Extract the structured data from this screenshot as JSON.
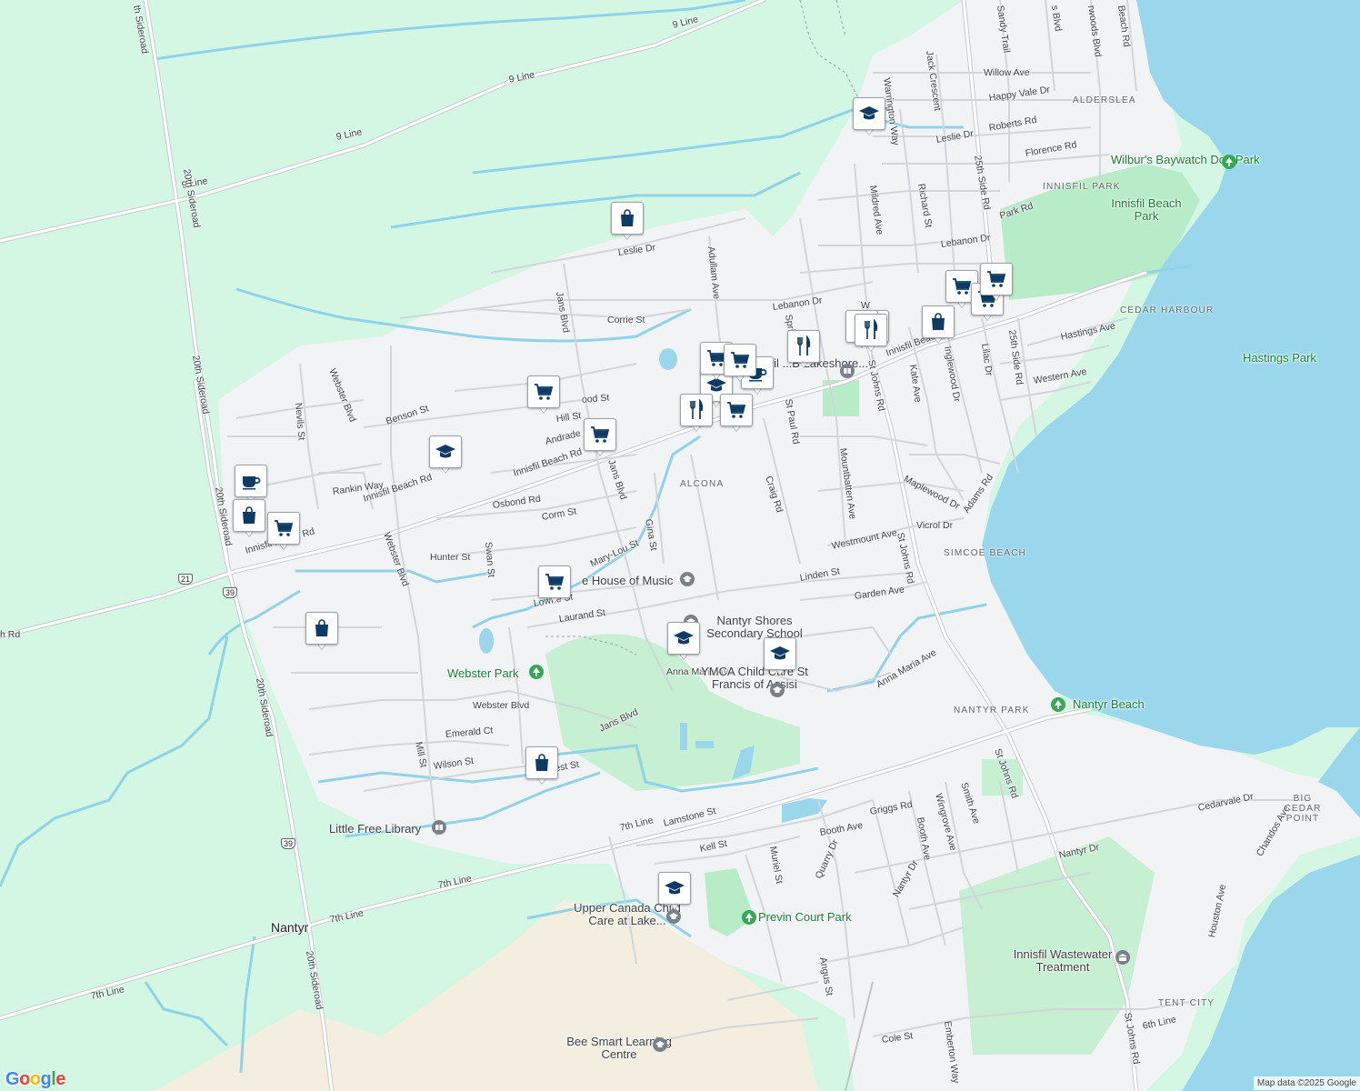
{
  "map": {
    "water_color": "#9bd7ec",
    "land_color": "#f1f3f4",
    "green_color": "#d4f7e4",
    "park_color": "#b8ebc7",
    "road_color": "#ffffff",
    "pin_icon_color": "#0d3b66"
  },
  "streets": [
    {
      "name": "9 Line"
    },
    {
      "name": "9 Line"
    },
    {
      "name": "9 Line"
    },
    {
      "name": "9 Line"
    },
    {
      "name": "20th Sideroad"
    },
    {
      "name": "20th Sideroad"
    },
    {
      "name": "20th Sideroad"
    },
    {
      "name": "20th Sideroad"
    },
    {
      "name": "20th Sideroad"
    },
    {
      "name": "th Sideroad"
    },
    {
      "name": "Leslie Dr"
    },
    {
      "name": "Corrie St"
    },
    {
      "name": "Jans Blvd"
    },
    {
      "name": "Adullam Ave"
    },
    {
      "name": "Lebanon Dr"
    },
    {
      "name": "Innisfil Beach Rd"
    },
    {
      "name": "Innisfil Beach Rd"
    },
    {
      "name": "Innisfil Beach Rd"
    },
    {
      "name": "Innisfil Beach Rd"
    },
    {
      "name": "Webster Blvd"
    },
    {
      "name": "Webster Blvd"
    },
    {
      "name": "Webster Blvd"
    },
    {
      "name": "Nevils St"
    },
    {
      "name": "Benson St"
    },
    {
      "name": "Rankin Way"
    },
    {
      "name": "Hill St"
    },
    {
      "name": "ood St"
    },
    {
      "name": "Andrade"
    },
    {
      "name": "Jans Blvd"
    },
    {
      "name": "Osbond Rd"
    },
    {
      "name": "Corm St"
    },
    {
      "name": "Swan St"
    },
    {
      "name": "Hunter St"
    },
    {
      "name": "Mary-Lou St"
    },
    {
      "name": "Gina St"
    },
    {
      "name": "Lowrie St"
    },
    {
      "name": "Laurand St"
    },
    {
      "name": "Craig Rd"
    },
    {
      "name": "St Paul Rd"
    },
    {
      "name": "Mountbatten Ave"
    },
    {
      "name": "Westmount Ave"
    },
    {
      "name": "Linden St"
    },
    {
      "name": "Garden Ave"
    },
    {
      "name": "Anna Maria Ave"
    },
    {
      "name": "Anna Maria Ave"
    },
    {
      "name": "Jans Blvd"
    },
    {
      "name": "Emerald Ct"
    },
    {
      "name": "Mill St"
    },
    {
      "name": "Wilson St"
    },
    {
      "name": "rest St"
    },
    {
      "name": "7th Line"
    },
    {
      "name": "7th Line"
    },
    {
      "name": "7th Line"
    },
    {
      "name": "7th Line"
    },
    {
      "name": "Lamstone St"
    },
    {
      "name": "Kell St"
    },
    {
      "name": "Booth Ave"
    },
    {
      "name": "Griggs Rd"
    },
    {
      "name": "Muriel St"
    },
    {
      "name": "Quarry Dr"
    },
    {
      "name": "Angus St"
    },
    {
      "name": "Nantyr Dr"
    },
    {
      "name": "Booth Ave"
    },
    {
      "name": "Wingrove Ave"
    },
    {
      "name": "Smith Ave"
    },
    {
      "name": "Nantyr Dr"
    },
    {
      "name": "Cedarvale Dr"
    },
    {
      "name": "Chandos Ave"
    },
    {
      "name": "Houston Ave"
    },
    {
      "name": "6th Line"
    },
    {
      "name": "Cole St"
    },
    {
      "name": "Emberton Way"
    },
    {
      "name": "St Johns Rd"
    },
    {
      "name": "St Johns Rd"
    },
    {
      "name": "St Johns Rd"
    },
    {
      "name": "St Johns Rd"
    },
    {
      "name": "Vicrol Dr"
    },
    {
      "name": "Maplewood Dr"
    },
    {
      "name": "Adams Rd"
    },
    {
      "name": "Kate Ave"
    },
    {
      "name": "Inglewood Dr"
    },
    {
      "name": "Lilac Dr"
    },
    {
      "name": "25th Side Rd"
    },
    {
      "name": "25th Side Rd"
    },
    {
      "name": "Western Ave"
    },
    {
      "name": "Hastings Ave"
    },
    {
      "name": "Mildred Ave"
    },
    {
      "name": "Richard St"
    },
    {
      "name": "Lebanon Dr"
    },
    {
      "name": "Leslie Dr"
    },
    {
      "name": "Roberts Rd"
    },
    {
      "name": "Florence Rd"
    },
    {
      "name": "Park Rd"
    },
    {
      "name": "Happy Vale Dr"
    },
    {
      "name": "Willow Ave"
    },
    {
      "name": "Jack Crescent"
    },
    {
      "name": "Warrington Way"
    },
    {
      "name": "Sandy Trail"
    },
    {
      "name": "Beach Rd"
    },
    {
      "name": "rwoods Blvd"
    },
    {
      "name": "s Blvd"
    },
    {
      "name": "Spri"
    },
    {
      "name": "W"
    },
    {
      "name": "h Rd"
    }
  ],
  "areas": [
    {
      "name": "ALDERSLEA"
    },
    {
      "name": "INNISFIL PARK"
    },
    {
      "name": "CEDAR HARBOUR"
    },
    {
      "name": "ALCONA"
    },
    {
      "name": "SIMCOE BEACH"
    },
    {
      "name": "NANTYR PARK"
    },
    {
      "name": "BIG CEDAR POINT"
    },
    {
      "name": "TENT CITY"
    }
  ],
  "places": [
    {
      "name": "Nantyr Shores Secondary School",
      "icon": "school-icon"
    },
    {
      "name": "YMCA Child Care St Francis of Assisi",
      "icon": "school-icon"
    },
    {
      "name": "e House of Music",
      "icon": "school-icon"
    },
    {
      "name": "Little Free Library",
      "icon": "library-icon"
    },
    {
      "name": "Upper Canada Child Care at Lake...",
      "icon": "school-icon"
    },
    {
      "name": "Bee Smart Learning Centre",
      "icon": "school-icon"
    },
    {
      "name": "Innisfil Wastewater Treatment",
      "icon": "building-icon"
    },
    {
      "name": "Innisfil ...B Lakeshore...",
      "icon": "library-icon"
    }
  ],
  "parks": [
    {
      "name": "Webster Park"
    },
    {
      "name": "Previn Court Park"
    },
    {
      "name": "Nantyr Beach"
    },
    {
      "name": "Hastings Park"
    },
    {
      "name": "Innisfil Beach Park"
    },
    {
      "name": "Wilbur's Baywatch Dog Park"
    }
  ],
  "towns": [
    {
      "name": "Nantyr"
    }
  ],
  "highway_shields": [
    {
      "number": "21"
    },
    {
      "number": "39"
    },
    {
      "number": "39"
    }
  ],
  "pins": [
    {
      "icon": "shopping-bag-icon"
    },
    {
      "icon": "graduation-cap-icon"
    },
    {
      "icon": "shopping-cart-icon"
    },
    {
      "icon": "shopping-cart-icon"
    },
    {
      "icon": "graduation-cap-icon"
    },
    {
      "icon": "coffee-icon"
    },
    {
      "icon": "shopping-bag-icon"
    },
    {
      "icon": "shopping-cart-icon"
    },
    {
      "icon": "shopping-cart-icon"
    },
    {
      "icon": "shopping-bag-icon"
    },
    {
      "icon": "graduation-cap-icon"
    },
    {
      "icon": "graduation-cap-icon"
    },
    {
      "icon": "shopping-bag-icon"
    },
    {
      "icon": "graduation-cap-icon"
    },
    {
      "icon": "shopping-cart-icon"
    },
    {
      "icon": "shopping-cart-icon"
    },
    {
      "icon": "shopping-cart-icon"
    },
    {
      "icon": "coffee-icon"
    },
    {
      "icon": "graduation-cap-icon"
    },
    {
      "icon": "utensils-icon"
    },
    {
      "icon": "shopping-cart-icon"
    },
    {
      "icon": "utensils-icon"
    },
    {
      "icon": "utensils-icon"
    },
    {
      "icon": "utensils-icon"
    },
    {
      "icon": "shopping-bag-icon"
    },
    {
      "icon": "shopping-cart-icon"
    },
    {
      "icon": "coffee-icon"
    },
    {
      "icon": "shopping-cart-icon"
    }
  ],
  "branding": {
    "logo": "Google",
    "attribution": "Map data ©2025 Google"
  }
}
